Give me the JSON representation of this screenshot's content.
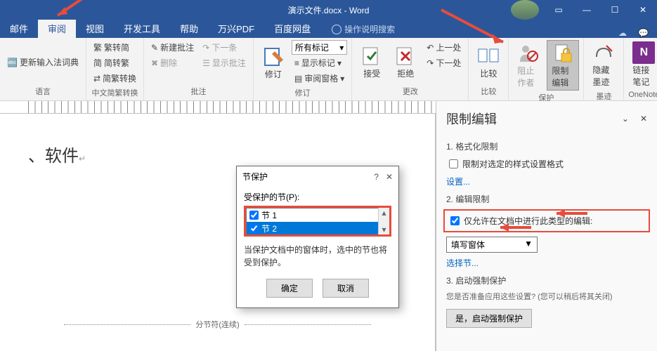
{
  "window": {
    "title": "演示文件.docx - Word"
  },
  "tabs": [
    {
      "label": "邮件"
    },
    {
      "label": "审阅",
      "active": true
    },
    {
      "label": "视图"
    },
    {
      "label": "开发工具"
    },
    {
      "label": "帮助"
    },
    {
      "label": "万兴PDF"
    },
    {
      "label": "百度网盘"
    }
  ],
  "tellMe": "操作说明搜索",
  "ribbon": {
    "group1": {
      "btn1": "更新输入法词典",
      "label": "语言"
    },
    "group2": {
      "btn1": "繁转简",
      "btn2": "简转繁",
      "btn3": "简繁转换",
      "label": "中文简繁转换"
    },
    "group3": {
      "btn1": "新建批注",
      "btn2": "删除",
      "btn3": "下一条",
      "btn4": "显示批注",
      "label": "批注"
    },
    "group4": {
      "btn1": "修订",
      "combo": "所有标记",
      "btn2": "显示标记",
      "btn3": "审阅窗格",
      "label": "修订"
    },
    "group5": {
      "btn1": "接受",
      "btn2": "拒绝",
      "btn3": "上一处",
      "btn4": "下一处",
      "label": "更改"
    },
    "group6": {
      "btn1": "比较",
      "label": "比较"
    },
    "group7": {
      "btn1": "阻止作者",
      "btn2": "限制编辑",
      "label": "保护"
    },
    "group8": {
      "btn1": "隐藏墨迹",
      "label": "墨迹"
    },
    "group9": {
      "btn1": "链接笔记",
      "label": "OneNote"
    }
  },
  "document": {
    "visible_text": "、软件",
    "section_break": "分节符(连续)"
  },
  "dialog": {
    "title": "节保护",
    "label": "受保护的节(P):",
    "items": [
      "节 1",
      "节 2"
    ],
    "info": "当保护文档中的窗体时，选中的节也将受到保护。",
    "ok": "确定",
    "cancel": "取消"
  },
  "taskPane": {
    "title": "限制编辑",
    "s1": {
      "header": "1. 格式化限制",
      "checkbox": "限制对选定的样式设置格式",
      "link": "设置..."
    },
    "s2": {
      "header": "2. 编辑限制",
      "checkbox": "仅允许在文档中进行此类型的编辑:",
      "select": "填写窗体",
      "link": "选择节..."
    },
    "s3": {
      "header": "3. 启动强制保护",
      "note": "您是否准备应用这些设置? (您可以稍后将其关闭)",
      "button": "是，启动强制保护"
    }
  }
}
